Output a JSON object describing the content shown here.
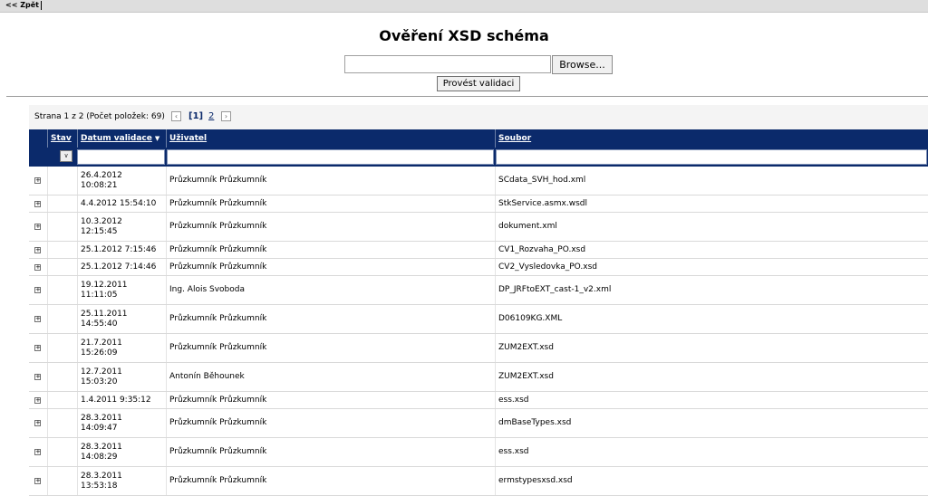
{
  "nav": {
    "back_label": "<< Zpět"
  },
  "page": {
    "title": "Ověření XSD schéma"
  },
  "upload": {
    "file_value": "",
    "browse_label": "Browse...",
    "validate_label": "Provést validaci"
  },
  "pager": {
    "summary": "Strana 1 z 2 (Počet položek: 69)",
    "prev_icon": "chevron-left-icon",
    "current_page": "[1]",
    "other_page": "2",
    "next_icon": "chevron-right-icon"
  },
  "table": {
    "columns": [
      "Stav",
      "Datum validace",
      "Uživatel",
      "Soubor"
    ],
    "sort_indicator": "▼",
    "expand_symbol": "+",
    "filter_select_symbol": "∨",
    "rows": [
      {
        "datum": "26.4.2012 10:08:21",
        "uzivatel": "Průzkumník Průzkumník",
        "soubor": "SCdata_SVH_hod.xml"
      },
      {
        "datum": "4.4.2012 15:54:10",
        "uzivatel": "Průzkumník Průzkumník",
        "soubor": "StkService.asmx.wsdl"
      },
      {
        "datum": "10.3.2012 12:15:45",
        "uzivatel": "Průzkumník Průzkumník",
        "soubor": "dokument.xml"
      },
      {
        "datum": "25.1.2012 7:15:46",
        "uzivatel": "Průzkumník Průzkumník",
        "soubor": "CV1_Rozvaha_PO.xsd"
      },
      {
        "datum": "25.1.2012 7:14:46",
        "uzivatel": "Průzkumník Průzkumník",
        "soubor": "CV2_Vysledovka_PO.xsd"
      },
      {
        "datum": "19.12.2011 11:11:05",
        "uzivatel": "Ing. Alois Svoboda",
        "soubor": "DP_JRFtoEXT_cast-1_v2.xml"
      },
      {
        "datum": "25.11.2011 14:55:40",
        "uzivatel": "Průzkumník Průzkumník",
        "soubor": "D06109KG.XML"
      },
      {
        "datum": "21.7.2011 15:26:09",
        "uzivatel": "Průzkumník Průzkumník",
        "soubor": "ZUM2EXT.xsd"
      },
      {
        "datum": "12.7.2011 15:03:20",
        "uzivatel": "Antonín Běhounek",
        "soubor": "ZUM2EXT.xsd"
      },
      {
        "datum": "1.4.2011 9:35:12",
        "uzivatel": "Průzkumník Průzkumník",
        "soubor": "ess.xsd"
      },
      {
        "datum": "28.3.2011 14:09:47",
        "uzivatel": "Průzkumník Průzkumník",
        "soubor": "dmBaseTypes.xsd"
      },
      {
        "datum": "28.3.2011 14:08:29",
        "uzivatel": "Průzkumník Průzkumník",
        "soubor": "ess.xsd"
      },
      {
        "datum": "28.3.2011 13:53:18",
        "uzivatel": "Průzkumník Průzkumník",
        "soubor": "ermstypesxsd.xsd"
      }
    ]
  }
}
